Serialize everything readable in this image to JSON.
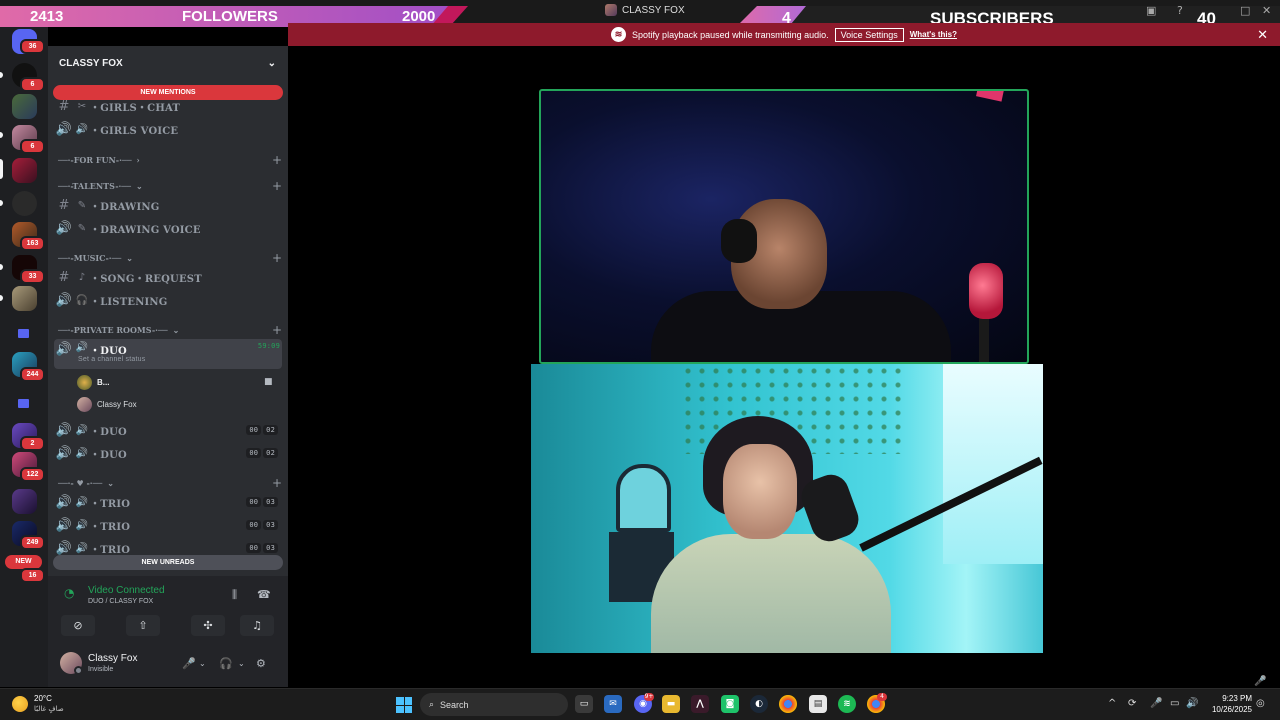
{
  "overlay": {
    "left_number": "2413",
    "followers_label": "FOLLOWERS",
    "followers_goal": "2000",
    "subs_number": "4",
    "subscribers_label": "SUBSCRIBERS",
    "right_number": "40",
    "accent_pink": "#e06aa8",
    "accent_purple": "#a24fc6"
  },
  "window": {
    "title": "CLASSY FOX"
  },
  "notice": {
    "message": "Spotify playback paused while transmitting audio.",
    "button_label": "Voice Settings",
    "link_label": "What's this?"
  },
  "servers": [
    {
      "icon": "discord-home-icon",
      "badge": "36"
    },
    {
      "icon": "server-avatar",
      "badge": "6"
    },
    {
      "icon": "server-avatar",
      "badge": ""
    },
    {
      "icon": "server-avatar",
      "badge": "6"
    },
    {
      "icon": "server-avatar-selected",
      "badge": ""
    },
    {
      "icon": "server-avatar",
      "badge": ""
    },
    {
      "icon": "server-avatar",
      "badge": "163"
    },
    {
      "icon": "server-avatar",
      "badge": "33"
    },
    {
      "icon": "server-avatar",
      "badge": ""
    },
    {
      "icon": "folder-icon",
      "badge": ""
    },
    {
      "icon": "server-avatar",
      "badge": "244"
    },
    {
      "icon": "folder-icon",
      "badge": ""
    },
    {
      "icon": "server-avatar",
      "badge": "2"
    },
    {
      "icon": "server-avatar",
      "badge": "122"
    },
    {
      "icon": "server-avatar",
      "badge": ""
    },
    {
      "icon": "server-avatar",
      "badge": "249"
    }
  ],
  "servers_new_label": "NEW",
  "servers_new_count": "16",
  "sidebar": {
    "server_name": "CLASSY FOX",
    "new_mentions": "NEW MENTIONS",
    "new_unreads": "NEW UNREADS",
    "channels": {
      "girls_chat": "・GIRLS・CHAT",
      "girls_voice": "・GIRLS VOICE",
      "cat_for_fun": "──·-FOR FUN-·──",
      "cat_talents": "──·-TALENTS-·──",
      "drawing": "・DRAWING",
      "drawing_voice": "・DRAWING VOICE",
      "cat_music": "──·-MUSIC-·──",
      "song_request": "・SONG・REQUEST",
      "listening": "・LISTENING",
      "cat_private": "──·-PRIVATE ROOMS-·──",
      "duo_active": "・DUO",
      "duo_timer": "59:09",
      "duo_status": "Set a channel status",
      "duo_2": "・DUO",
      "duo_3": "・DUO",
      "cat_heart": "──·- ♥ -·──",
      "trio_1": "・TRIO",
      "trio_2": "・TRIO",
      "trio_3": "・TRIO"
    },
    "counts": {
      "duo_2": [
        "00",
        "02"
      ],
      "duo_3": [
        "00",
        "02"
      ],
      "trio_1": [
        "00",
        "03"
      ],
      "trio_2": [
        "00",
        "03"
      ],
      "trio_3": [
        "00",
        "03"
      ]
    },
    "voice_users": [
      {
        "name": "B..."
      },
      {
        "name": "Classy Fox"
      }
    ]
  },
  "panel": {
    "vc_title": "Video Connected",
    "vc_sub": "DUO / CLASSY FOX",
    "user_name": "Classy Fox",
    "user_status": "Invisible"
  },
  "taskbar": {
    "temp": "20°C",
    "weather_desc": "صافٍ غالبًا",
    "search_label": "Search",
    "time": "9:23 PM",
    "date": "10/26/2025",
    "discord_badge": "9+",
    "chrome_badge": "4"
  }
}
